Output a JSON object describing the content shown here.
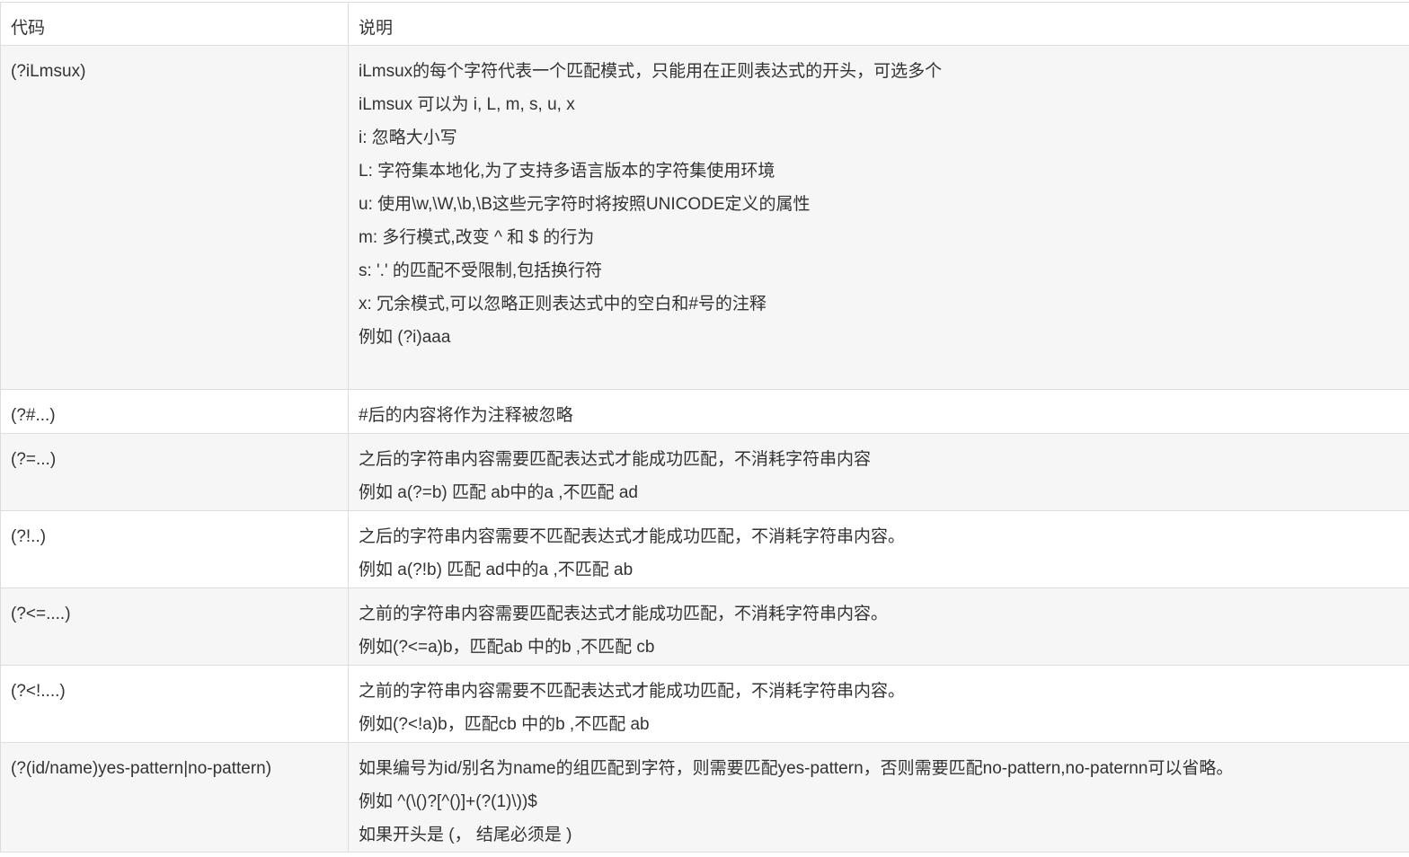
{
  "header": {
    "code": "代码",
    "desc": "说明"
  },
  "rows": [
    {
      "code": "(?iLmsux)",
      "lines": [
        "iLmsux的每个字符代表一个匹配模式，只能用在正则表达式的开头，可选多个",
        "iLmsux 可以为 i, L, m, s, u, x",
        "i: 忽略大小写",
        "L: 字符集本地化,为了支持多语言版本的字符集使用环境",
        "u: 使用\\w,\\W,\\b,\\B这些元字符时将按照UNICODE定义的属性",
        "m: 多行模式,改变 ^ 和 $ 的行为",
        "s: '.' 的匹配不受限制,包括换行符",
        "x: 冗余模式,可以忽略正则表达式中的空白和#号的注释",
        "例如 (?i)aaa"
      ]
    },
    {
      "code": "(?#...)",
      "lines": [
        "#后的内容将作为注释被忽略"
      ]
    },
    {
      "code": "(?=...)",
      "lines": [
        "之后的字符串内容需要匹配表达式才能成功匹配，不消耗字符串内容",
        "例如 a(?=b) 匹配 ab中的a ,不匹配 ad"
      ]
    },
    {
      "code": "(?!..)",
      "lines": [
        "之后的字符串内容需要不匹配表达式才能成功匹配，不消耗字符串内容。",
        "例如 a(?!b) 匹配 ad中的a ,不匹配 ab"
      ]
    },
    {
      "code": "(?<=....)",
      "lines": [
        "之前的字符串内容需要匹配表达式才能成功匹配，不消耗字符串内容。",
        "例如(?<=a)b，匹配ab 中的b ,不匹配 cb"
      ]
    },
    {
      "code": "(?<!....)",
      "lines": [
        "之前的字符串内容需要不匹配表达式才能成功匹配，不消耗字符串内容。",
        "例如(?<!a)b，匹配cb 中的b ,不匹配 ab"
      ]
    },
    {
      "code": "(?(id/name)yes-pattern|no-pattern)",
      "lines": [
        "如果编号为id/别名为name的组匹配到字符，则需要匹配yes-pattern，否则需要匹配no-pattern,no-paternn可以省略。",
        "例如 ^(\\()?[^()]+(?(1)\\))$",
        "如果开头是 (， 结尾必须是 )"
      ]
    }
  ]
}
